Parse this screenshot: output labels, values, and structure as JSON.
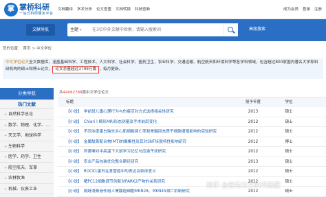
{
  "brand": {
    "name": "掌桥科研",
    "tagline": "一站式科研服务平台",
    "mark": "掌"
  },
  "top_nav": [
    "文档翻译",
    "学术分析",
    "论文查重",
    "文档转换",
    "科技查新"
  ],
  "top_right": [
    "成为会员",
    "登录",
    "注册"
  ],
  "search": {
    "doc_nav": "文献导航",
    "scope": "主题",
    "placeholder": "在3亿中外文献中检索，请输入搜索词",
    "advanced": "高级搜索"
  },
  "breadcrumb": {
    "label": "您的位置：",
    "home": "首页",
    "sep": ">",
    "current": "中文学位"
  },
  "intro": {
    "highlight": "中文学位论文",
    "text1": "全文数据库，涵盖基础科学、工程技术、人文科学、社会科学、医药卫生、农业科学、交通运输、航空航天和环境科学等各学科领域，包含超过800家国内著名大学和科研机构的硕士和博士论文，",
    "count_text": "论文总量超过3799万篇",
    "text2": "，每月更新。"
  },
  "sidebar": {
    "header": "分类导航",
    "subheader": "热门文献",
    "items": [
      "自然科学总论",
      "数学、物理、化学、…",
      "天文学、地球科学",
      "生物科学",
      "医学、药学、卫生",
      "航空航天、军事",
      "农林牧渔",
      "机械、仪表工业"
    ]
  },
  "main": {
    "total_prefix": "共",
    "total_num": "44082788",
    "total_suffix": "篇中文学位论文",
    "columns": [
      "标题",
      "授予年度",
      "学位"
    ],
    "rows": [
      {
        "tag": "【小说】",
        "title": "学前班儿童心理行为与伤痕应对方式选择相关性研究",
        "year": "2013",
        "degree": "硕士"
      },
      {
        "tag": "【小说】",
        "title": "Chiari Ⅰ 畸形MRI形态测量及手术前后变化",
        "year": "2012",
        "degree": "硕士"
      },
      {
        "tag": "【小说】",
        "title": "不同浓度蛋白缺失对心肌细胞凋亡率和骨髓间充质干细胞增殖影响的实验研究",
        "year": "2012",
        "degree": "硕士"
      },
      {
        "tag": "【小说】",
        "title": "金属酞菁配合物(MT)的聚集性及其对SNT拆胶特性影响研究",
        "year": "2012",
        "degree": "博士"
      },
      {
        "tag": "【小说】",
        "title": "异黄嗪对中高温下大鼠学习记忆与应激干扰研究",
        "year": "2012",
        "degree": "硕士"
      },
      {
        "tag": "【小说】",
        "title": "农业产品包装优化整合路径研究",
        "year": "2013",
        "degree": "硕士"
      },
      {
        "tag": "【小说】",
        "title": "ROCK1蛋白在食管癌中的表达及临床意义",
        "year": "2012",
        "degree": "硕士"
      },
      {
        "tag": "【小说】",
        "title": "猪PC12细胞调节创新对PARK2产物的关系研究",
        "year": "2012",
        "degree": "硕士"
      },
      {
        "tag": "【小说】",
        "title": "桃蚜浸膏液作用人胃腺癌细胞MKN28、MKN45凋亡机制研究",
        "year": "2012",
        "degree": "硕士"
      }
    ]
  },
  "watermark": "知乎 @尝找论文的鸡翅握"
}
